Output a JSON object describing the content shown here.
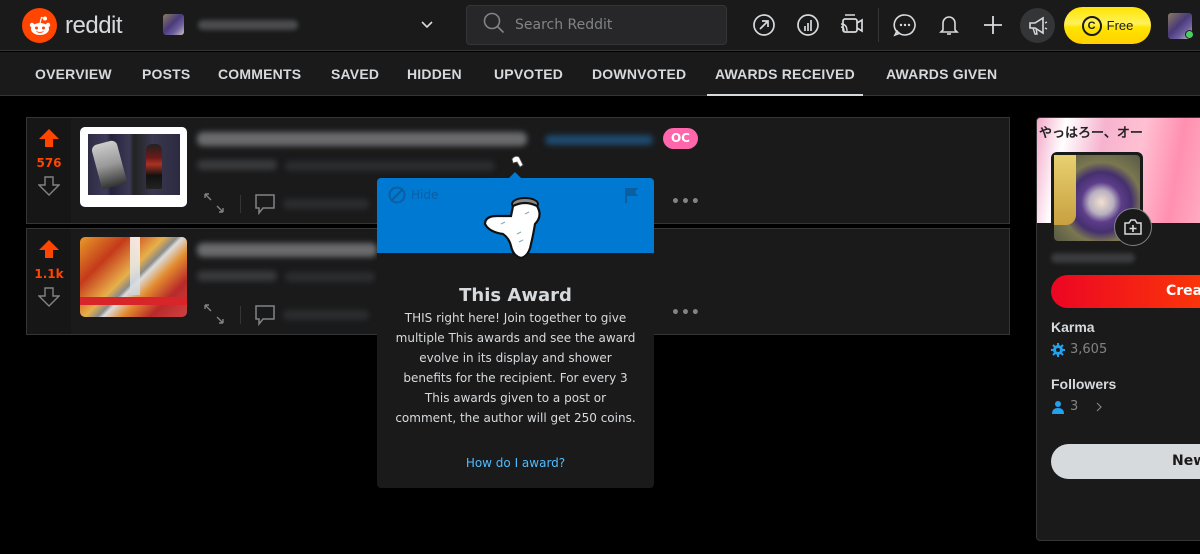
{
  "header": {
    "logo_text": "reddit",
    "search_placeholder": "Search Reddit",
    "free_button_label": "Free",
    "coin_glyph": "C",
    "icons": [
      "popular-icon",
      "stats-icon",
      "live-icon",
      "chat-icon",
      "notifications-icon",
      "create-post-icon",
      "advertise-icon"
    ]
  },
  "tabs": [
    {
      "label": "OVERVIEW",
      "active": false
    },
    {
      "label": "POSTS",
      "active": false
    },
    {
      "label": "COMMENTS",
      "active": false
    },
    {
      "label": "SAVED",
      "active": false
    },
    {
      "label": "HIDDEN",
      "active": false
    },
    {
      "label": "UPVOTED",
      "active": false
    },
    {
      "label": "DOWNVOTED",
      "active": false
    },
    {
      "label": "AWARDS RECEIVED",
      "active": true
    },
    {
      "label": "AWARDS GIVEN",
      "active": false
    }
  ],
  "posts": [
    {
      "score": "576",
      "flair": "OC",
      "thumbnail": "anime-fight-scene"
    },
    {
      "score": "1.1k",
      "flair": "",
      "thumbnail": "autumn-waterfall-bridge"
    }
  ],
  "popover": {
    "hide_label": "Hide",
    "title": "This Award",
    "description": "THIS right here! Join together to give multiple This awards and see the award evolve in its display and shower benefits for the recipient. For every 3 This awards given to a post or comment, the author will get 250 coins.",
    "link_label": "How do I award?",
    "header_color": "#0079d3"
  },
  "sidebar": {
    "banner_text": "やっはろー、オー",
    "create_button_label": "Create",
    "karma_label": "Karma",
    "karma_value": "3,605",
    "followers_label": "Followers",
    "followers_value": "3",
    "new_button_label": "New"
  },
  "colors": {
    "accent": "#ff4500",
    "upvote": "#ff4500",
    "link": "#4fbcff",
    "oc_flair": "#ff66ac",
    "free_button": "#ffe500"
  }
}
